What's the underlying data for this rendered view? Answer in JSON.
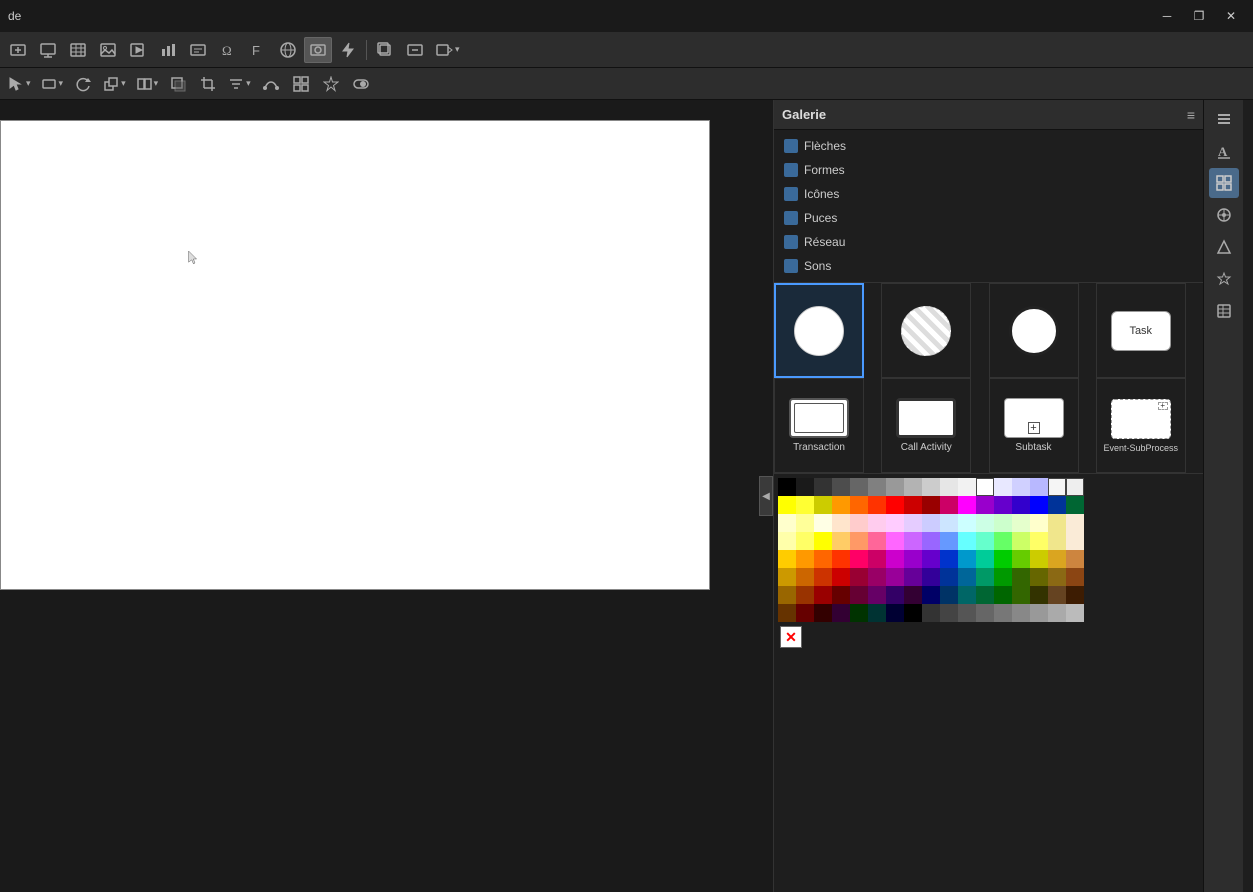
{
  "titlebar": {
    "title": "de",
    "minimize_label": "─",
    "maximize_label": "❐",
    "close_label": "✕"
  },
  "toolbar1": {
    "buttons": [
      {
        "id": "insert-slide",
        "icon": "⊞",
        "label": "Insert Slide"
      },
      {
        "id": "insert-table",
        "icon": "⊟",
        "label": "Insert Table"
      },
      {
        "id": "insert-chart",
        "icon": "⊠",
        "label": "Insert Chart"
      },
      {
        "id": "insert-image",
        "icon": "⊡",
        "label": "Insert Image"
      },
      {
        "id": "insert-media",
        "icon": "▷",
        "label": "Insert Media"
      },
      {
        "id": "insert-formula",
        "icon": "Ω",
        "label": "Insert Formula"
      },
      {
        "id": "insert-text",
        "icon": "T",
        "label": "Insert Text"
      },
      {
        "id": "insert-link",
        "icon": "🔗",
        "label": "Insert Link"
      },
      {
        "id": "insert-photo",
        "icon": "📷",
        "label": "Insert Photo"
      },
      {
        "id": "insert-flash",
        "icon": "⚡",
        "label": "Insert Flash"
      },
      {
        "id": "insert-copy",
        "icon": "⧉",
        "label": "Copy"
      },
      {
        "id": "insert-field",
        "icon": "⊞",
        "label": "Insert Field"
      },
      {
        "id": "insert-display",
        "icon": "⊟",
        "label": "Display"
      }
    ]
  },
  "toolbar2": {
    "buttons": [
      {
        "id": "pointer",
        "icon": "↖",
        "label": "Pointer"
      },
      {
        "id": "rect",
        "icon": "□",
        "label": "Rectangle"
      },
      {
        "id": "rotate",
        "icon": "↺",
        "label": "Rotate"
      },
      {
        "id": "arrange",
        "icon": "⊞",
        "label": "Arrange"
      },
      {
        "id": "flip",
        "icon": "⊟",
        "label": "Flip"
      },
      {
        "id": "shadow",
        "icon": "▣",
        "label": "Shadow"
      },
      {
        "id": "crop",
        "icon": "⊕",
        "label": "Crop"
      },
      {
        "id": "filter",
        "icon": "⊠",
        "label": "Filter"
      },
      {
        "id": "points",
        "icon": "∾",
        "label": "Points"
      },
      {
        "id": "select",
        "icon": "⊡",
        "label": "Select"
      },
      {
        "id": "mark",
        "icon": "⬥",
        "label": "Mark"
      },
      {
        "id": "toggle",
        "icon": "⊞⊟",
        "label": "Toggle"
      }
    ]
  },
  "galerie": {
    "title": "Galerie",
    "menu_icon": "≡",
    "categories": [
      {
        "id": "fleches",
        "label": "Flèches"
      },
      {
        "id": "formes",
        "label": "Formes"
      },
      {
        "id": "icones",
        "label": "Icônes"
      },
      {
        "id": "puces",
        "label": "Puces"
      },
      {
        "id": "reseau",
        "label": "Réseau"
      },
      {
        "id": "sons",
        "label": "Sons"
      }
    ],
    "shapes": [
      {
        "id": "circle-thin",
        "type": "circle-thin",
        "label": ""
      },
      {
        "id": "circle-dashed",
        "type": "circle-dashed",
        "label": ""
      },
      {
        "id": "circle-thick",
        "type": "circle-thick",
        "label": ""
      },
      {
        "id": "task",
        "type": "task",
        "label": "Task"
      },
      {
        "id": "transaction",
        "type": "transaction",
        "label": "Transaction"
      },
      {
        "id": "call-activity",
        "type": "call-activity",
        "label": "Call Activity"
      },
      {
        "id": "subtask",
        "type": "subtask",
        "label": "Subtask"
      },
      {
        "id": "event-subprocess",
        "type": "event-subprocess",
        "label": "Event-SubProcess"
      }
    ]
  },
  "color_palette": {
    "rows": [
      [
        "#000000",
        "#1a1a1a",
        "#333333",
        "#4d4d4d",
        "#666666",
        "#808080",
        "#999999",
        "#b3b3b3",
        "#cccccc",
        "#e6e6e6",
        "#f2f2f2",
        "#ffffff",
        "#e6e6ff",
        "#ccccff",
        "#b3b3ff",
        "#f5f5f5",
        "#eeeeee"
      ],
      [
        "#ffff00",
        "#ffff33",
        "#cccc00",
        "#ff9900",
        "#ff6600",
        "#ff3300",
        "#ff0000",
        "#cc0000",
        "#990000",
        "#cc0066",
        "#ff00ff",
        "#9900cc",
        "#6600cc",
        "#3300cc",
        "#0000ff",
        "#003399",
        "#006633"
      ],
      [
        "#ffffcc",
        "#ffff99",
        "#ffffcc",
        "#ffe5cc",
        "#ffcccc",
        "#ffccee",
        "#ffccff",
        "#e5ccff",
        "#ccccff",
        "#cce5ff",
        "#ccffff",
        "#ccffe5",
        "#ccffcc",
        "#e5ffcc",
        "#ffffcc",
        "#f5f5dc",
        "#ffffff"
      ],
      [
        "#ffffaa",
        "#ffff66",
        "#ffff00",
        "#ffcc66",
        "#ff9966",
        "#ff6699",
        "#ff66ff",
        "#cc66ff",
        "#9966ff",
        "#6699ff",
        "#66ffff",
        "#66ffcc",
        "#66ff66",
        "#ccff66",
        "#ffff66",
        "#f0e68c",
        "#faebd7"
      ],
      [
        "#ffcc00",
        "#ff9900",
        "#ff6600",
        "#ff3300",
        "#ff0066",
        "#cc0066",
        "#cc00cc",
        "#9900cc",
        "#6600cc",
        "#0033cc",
        "#0099cc",
        "#00cc99",
        "#00cc00",
        "#66cc00",
        "#cccc00",
        "#daa520",
        "#cd853f"
      ],
      [
        "#cc9900",
        "#cc6600",
        "#cc3300",
        "#cc0000",
        "#990033",
        "#990066",
        "#990099",
        "#660099",
        "#330099",
        "#003399",
        "#006699",
        "#009966",
        "#009900",
        "#336600",
        "#666600",
        "#8b6914",
        "#8b4513"
      ],
      [
        "#996600",
        "#993300",
        "#990000",
        "#660000",
        "#660033",
        "#660066",
        "#330066",
        "#330033",
        "#000066",
        "#003366",
        "#006666",
        "#006633",
        "#006600",
        "#336600",
        "#333300",
        "#654321",
        "#3d1c02"
      ],
      [
        "#663300",
        "#660000",
        "#330000",
        "#330033",
        "#003300",
        "#003333",
        "#000033",
        "#000000",
        "#333333",
        "#444444",
        "#555555",
        "#666666",
        "#777777",
        "#888888",
        "#999999",
        "#aaaaaa",
        "#bbbbbb"
      ]
    ]
  },
  "side_icons": [
    {
      "id": "properties",
      "icon": "≡",
      "label": "Properties"
    },
    {
      "id": "styles",
      "icon": "A",
      "label": "Styles"
    },
    {
      "id": "gallery",
      "icon": "⊞",
      "label": "Gallery",
      "active": true
    },
    {
      "id": "navigator",
      "icon": "◎",
      "label": "Navigator"
    },
    {
      "id": "shapes",
      "icon": "⬟",
      "label": "Shapes"
    },
    {
      "id": "favorites",
      "icon": "★",
      "label": "Favorites"
    },
    {
      "id": "table",
      "icon": "⊟",
      "label": "Table"
    }
  ]
}
